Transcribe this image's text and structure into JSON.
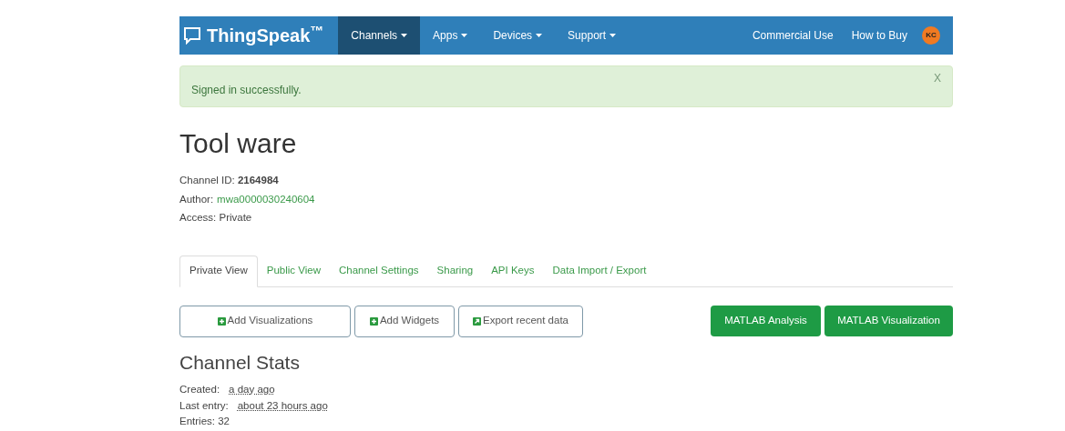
{
  "navbar": {
    "brand": "ThingSpeak$^{™}$",
    "menus": [
      {
        "label": "Channels",
        "selected": true
      },
      {
        "label": "Apps",
        "selected": false
      },
      {
        "label": "Devices",
        "selected": false
      },
      {
        "label": "Support",
        "selected": false
      }
    ],
    "links": [
      "Commercial Use",
      "How to Buy"
    ],
    "avatar": "KC"
  },
  "alert": {
    "message": "Signed in successfully.",
    "close": "X"
  },
  "channel": {
    "title": "Tool ware",
    "id_line": "Channel ID: **2164984**",
    "author_label": "Author:",
    "author": "mwa0000030240604",
    "access": "Access: Private"
  },
  "tabs": [
    {
      "label": "Private View",
      "selected": true
    },
    {
      "label": "Public View",
      "selected": false
    },
    {
      "label": "Channel Settings",
      "selected": false
    },
    {
      "label": "Sharing",
      "selected": false
    },
    {
      "label": "API Keys",
      "selected": false
    },
    {
      "label": "Data Import / Export",
      "selected": false
    }
  ],
  "actions": [
    {
      "label": "Add Visualizations",
      "kind": "plus"
    },
    {
      "label": "Add Widgets",
      "kind": "plus"
    },
    {
      "label": "Export recent data",
      "kind": "export"
    }
  ],
  "matlab": [
    "MATLAB Analysis",
    "MATLAB Visualization"
  ],
  "stats": {
    "title": "Channel Stats",
    "rows": [
      {
        "label": "Created:",
        "value": "a day ago"
      },
      {
        "label": "Last entry:",
        "value": "about 23 hours ago"
      }
    ],
    "entries": "Entries: 32"
  }
}
